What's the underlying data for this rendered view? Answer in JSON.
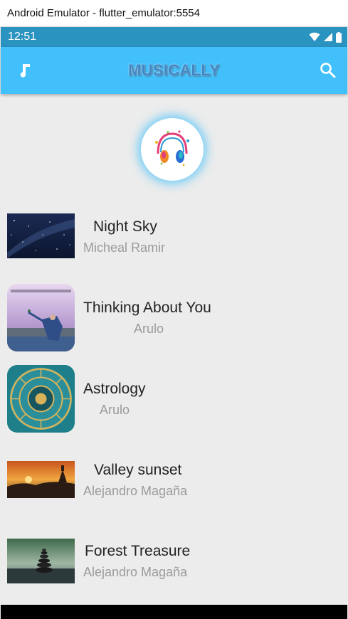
{
  "window": {
    "title": "Android Emulator - flutter_emulator:5554"
  },
  "status_bar": {
    "time": "12:51",
    "icons": [
      "wifi-icon",
      "signal-icon",
      "battery-icon"
    ]
  },
  "app_bar": {
    "title": "MUSICALLY",
    "leading_icon": "music-note-icon",
    "trailing_icon": "search-icon"
  },
  "logo": {
    "icon": "headphones-logo-icon"
  },
  "songs": [
    {
      "title": "Night Sky",
      "artist": "Micheal Ramir",
      "thumbnail": "night-sky-thumbnail"
    },
    {
      "title": "Thinking About You",
      "artist": "Arulo",
      "thumbnail": "thinking-about-you-thumbnail"
    },
    {
      "title": "Astrology",
      "artist": "Arulo",
      "thumbnail": "astrology-thumbnail"
    },
    {
      "title": "Valley sunset",
      "artist": "Alejandro Magaña",
      "thumbnail": "valley-sunset-thumbnail"
    },
    {
      "title": "Forest Treasure",
      "artist": "Alejandro Magaña",
      "thumbnail": "forest-treasure-thumbnail"
    }
  ],
  "colors": {
    "app_bar": "#41c0fb",
    "status_bar": "#2b93c0",
    "background": "#ececec",
    "title": "#3f88c8"
  }
}
